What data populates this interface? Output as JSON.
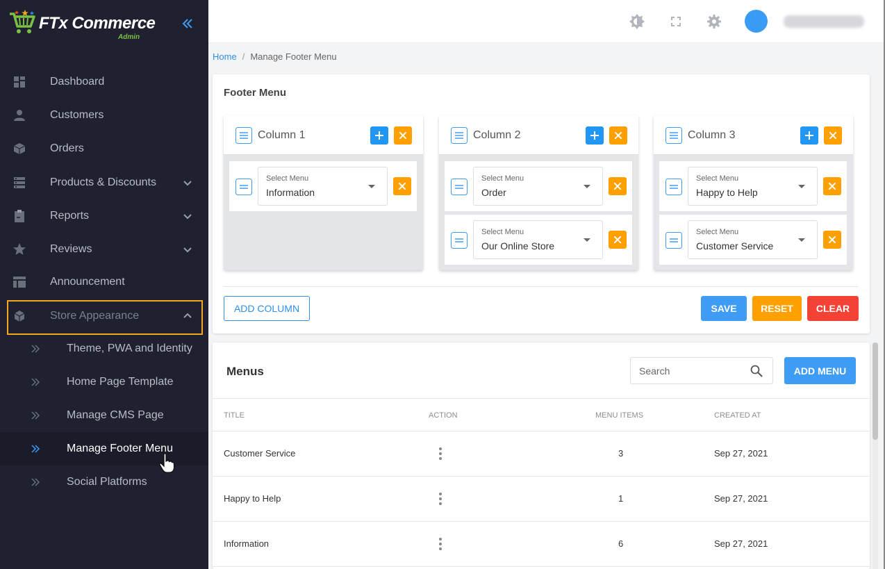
{
  "logo": {
    "brand": "FTx Commerce",
    "sub": "Admin"
  },
  "sidebar": {
    "items": [
      {
        "label": "Dashboard",
        "icon": "dashboard-icon"
      },
      {
        "label": "Customers",
        "icon": "person-icon"
      },
      {
        "label": "Orders",
        "icon": "box-icon"
      },
      {
        "label": "Products & Discounts",
        "icon": "server-icon"
      },
      {
        "label": "Reports",
        "icon": "clipboard-icon"
      },
      {
        "label": "Reviews",
        "icon": "star-icon"
      },
      {
        "label": "Announcement",
        "icon": "layout-icon"
      },
      {
        "label": "Store Appearance",
        "icon": "cube-icon"
      }
    ],
    "subitems": [
      {
        "label": "Theme, PWA and Identity"
      },
      {
        "label": "Home Page Template"
      },
      {
        "label": "Manage CMS Page"
      },
      {
        "label": "Manage Footer Menu"
      },
      {
        "label": "Social Platforms"
      }
    ],
    "active_color": "#f5a623"
  },
  "topbar": {
    "icons": [
      "brightness-icon",
      "fullscreen-icon",
      "settings-icon"
    ],
    "avatar_color": "#3a9bf5"
  },
  "breadcrumb": {
    "home": "Home",
    "separator": "/",
    "current": "Manage Footer Menu"
  },
  "footer_menu": {
    "title": "Footer Menu",
    "select_label": "Select Menu",
    "columns": [
      {
        "title": "Column 1",
        "menus": [
          "Information"
        ]
      },
      {
        "title": "Column 2",
        "menus": [
          "Order",
          "Our Online Store"
        ]
      },
      {
        "title": "Column 3",
        "menus": [
          "Happy to Help",
          "Customer Service"
        ]
      }
    ],
    "add_column_label": "ADD COLUMN",
    "save_label": "SAVE",
    "reset_label": "RESET",
    "clear_label": "CLEAR",
    "colors": {
      "save": "#3f9cf5",
      "reset": "#ffa000",
      "clear": "#f44336"
    }
  },
  "menus": {
    "title": "Menus",
    "search_placeholder": "Search",
    "add_menu_label": "ADD MENU",
    "columns": [
      "TITLE",
      "ACTION",
      "MENU ITEMS",
      "CREATED AT"
    ],
    "rows": [
      {
        "title": "Customer Service",
        "items": "3",
        "created": "Sep 27, 2021"
      },
      {
        "title": "Happy to Help",
        "items": "1",
        "created": "Sep 27, 2021"
      },
      {
        "title": "Information",
        "items": "6",
        "created": "Sep 27, 2021"
      }
    ]
  }
}
